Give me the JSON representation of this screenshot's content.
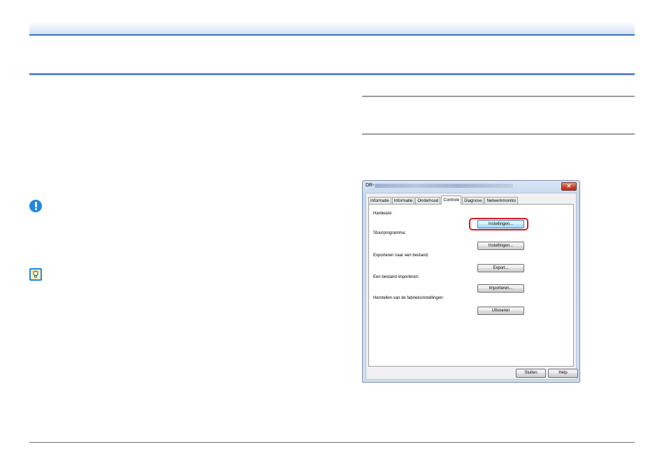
{
  "dialog": {
    "title_prefix": "DR-",
    "close_glyph": "✕",
    "tabs": [
      {
        "label": "Informatie"
      },
      {
        "label": "Informatie"
      },
      {
        "label": "Onderhoud"
      },
      {
        "label": "Controle"
      },
      {
        "label": "Diagnose"
      },
      {
        "label": "Netwerkmonitor"
      }
    ],
    "active_tab": "Controle",
    "sections": [
      {
        "label": "Hardware:",
        "button": "Instellingen..."
      },
      {
        "label": "Stuurprogramma:",
        "button": "Instellingen..."
      },
      {
        "label": "Exporteren naar een bestand:",
        "button": "Export..."
      },
      {
        "label": "Een bestand importeren:",
        "button": "Importeren..."
      },
      {
        "label": "Herstellen van de fabrieksinstellingen:",
        "button": "Uitvoeren"
      }
    ],
    "footer": {
      "close": "Sluiten",
      "help": "Help"
    }
  },
  "icons": {
    "important": "important-icon",
    "hint": "hint-icon"
  },
  "colors": {
    "accent_blue": "#3a6fc7",
    "icon_blue": "#1e88e5",
    "highlight_red": "#e0161e"
  }
}
